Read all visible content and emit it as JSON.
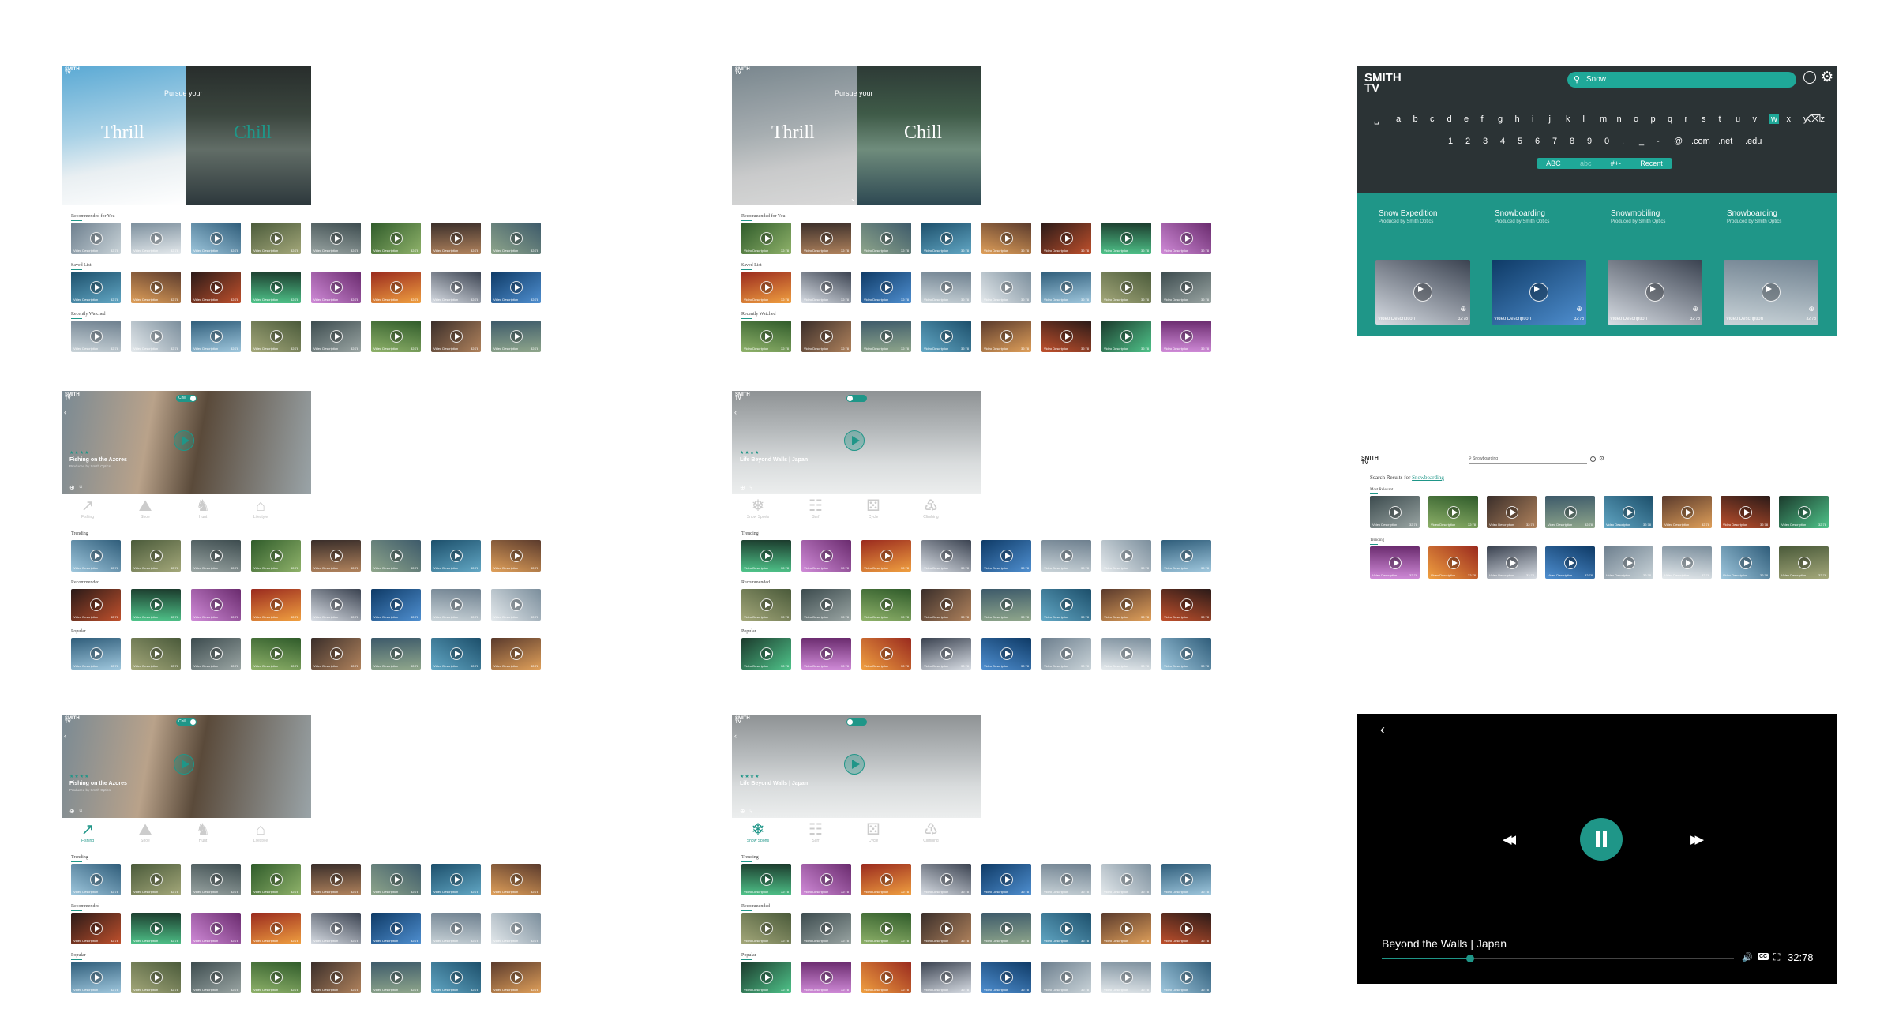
{
  "brand": {
    "logo_line1": "SMITH",
    "logo_line2": "TV"
  },
  "accent": "#1f9688",
  "icons": {
    "search": "search-icon",
    "account": "account-icon",
    "settings": "gear-icon"
  },
  "home_a": {
    "tagline": "Pursue your",
    "left_word": "Thrill",
    "right_word": "Chill",
    "rows": [
      "Recommended for You",
      "Saved List",
      "Recently Watched"
    ]
  },
  "home_b": {
    "tagline": "Pursue your",
    "left_word": "Thrill",
    "right_word": "Chill",
    "rows": [
      "Recommended for You",
      "Saved List",
      "Recently Watched"
    ]
  },
  "chill_page": {
    "toggle_label": "Chill",
    "title": "Fishing on the Azores",
    "subtitle": "Produced by Smith Optics",
    "rating_stars": 4,
    "categories": [
      "Fishing",
      "Shoe",
      "Hunt",
      "Lifestyle"
    ],
    "rows": [
      "Trending",
      "Recommended",
      "Popular"
    ]
  },
  "thrill_page": {
    "title": "Life Beyond Walls | Japan",
    "subtitle": "Produced by SMITH Media | RDN",
    "rating_stars": 4,
    "categories": [
      "Snow Sports",
      "Surf",
      "Cycle",
      "Climbing"
    ],
    "rows": [
      "Trending",
      "Recommended",
      "Popular"
    ]
  },
  "search_keyboard": {
    "query": "Snow",
    "letters": [
      "a",
      "b",
      "c",
      "d",
      "e",
      "f",
      "g",
      "h",
      "i",
      "j",
      "k",
      "l",
      "m",
      "n",
      "o",
      "p",
      "q",
      "r",
      "s",
      "t",
      "u",
      "v",
      "w",
      "x",
      "y",
      "z"
    ],
    "numbers": [
      "1",
      "2",
      "3",
      "4",
      "5",
      "6",
      "7",
      "8",
      "9",
      "0",
      ".",
      "_",
      "-",
      "@",
      ".com",
      ".net",
      ".edu"
    ],
    "modes": [
      "ABC",
      "abc",
      "#+-",
      "Recent"
    ],
    "suggestions": [
      {
        "title": "Snow Expedition",
        "by": "Produced by Smith Optics"
      },
      {
        "title": "Snowboarding",
        "by": "Produced by Smith Optics"
      },
      {
        "title": "Snowmobiling",
        "by": "Produced by Smith Optics"
      },
      {
        "title": "Snowboarding",
        "by": "Produced by Smith Optics"
      }
    ],
    "result_caption": "Video Description",
    "result_duration": "32:78"
  },
  "search_results": {
    "query": "Snowboarding",
    "heading_prefix": "Search Results for",
    "heading_term": "Snowboarding",
    "rows": [
      "Most Relevant",
      "Trending"
    ]
  },
  "player": {
    "title": "Beyond the Walls | Japan",
    "time": "32:78",
    "progress": 0.25,
    "cc_label": "CC"
  },
  "tile_caption": "Video Description",
  "tile_duration": "32:78"
}
